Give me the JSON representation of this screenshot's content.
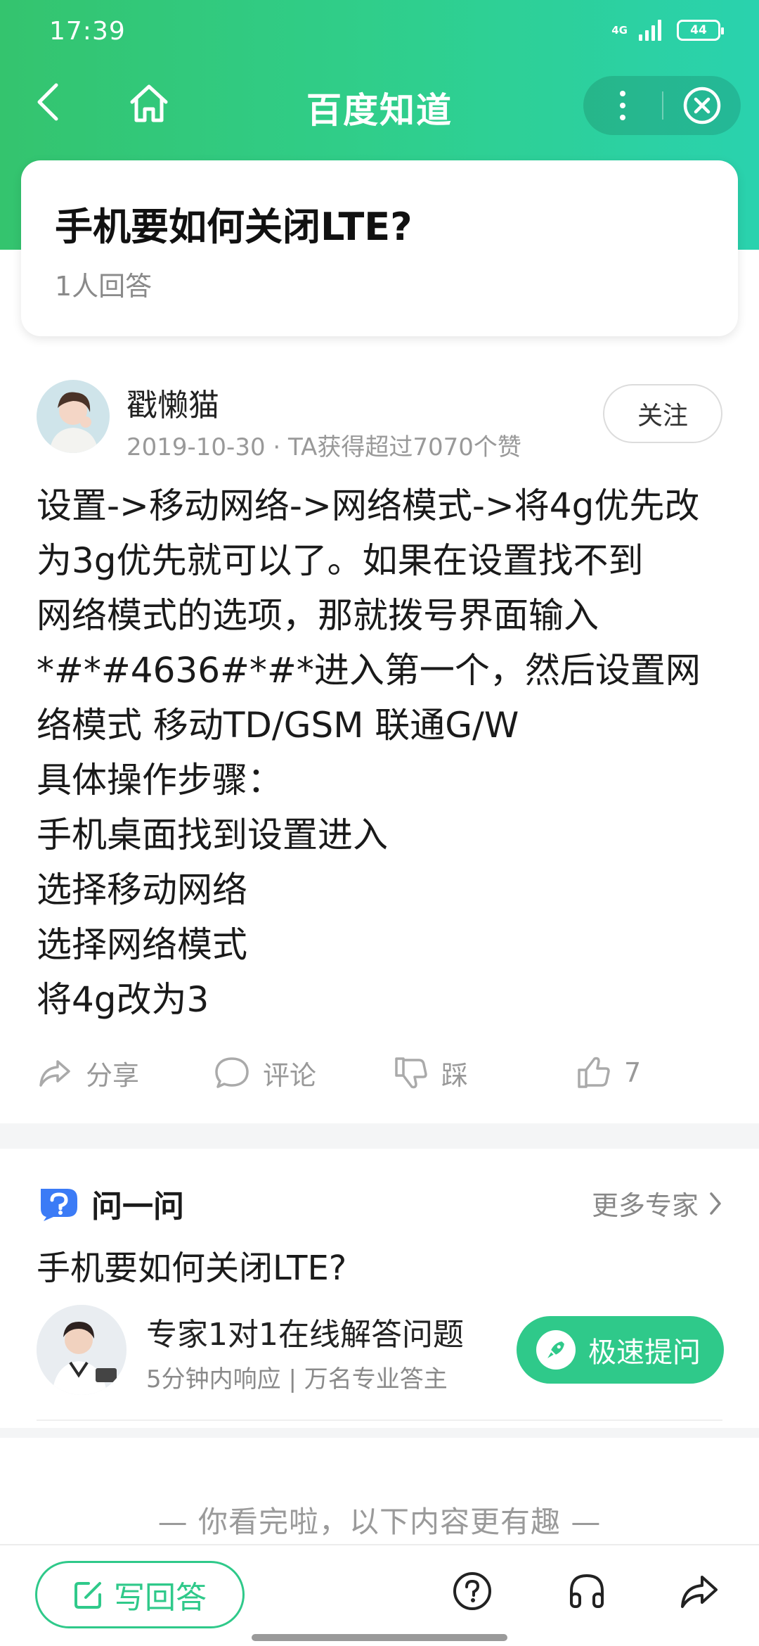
{
  "status_bar": {
    "time": "17:39",
    "network": "4G",
    "battery": "44"
  },
  "nav": {
    "title": "百度知道",
    "back_icon": "back-arrow-icon",
    "home_icon": "home-icon",
    "more_icon": "more-dots-icon",
    "close_icon": "close-circle-icon"
  },
  "question": {
    "title": "手机要如何关闭LTE?",
    "answer_count": "1人回答"
  },
  "answer": {
    "author": "戳懒猫",
    "meta": "2019-10-30 · TA获得超过7070个赞",
    "follow_label": "关注",
    "lines": [
      "设置->移动网络->网络模式->将4g优先改",
      "为3g优先就可以了。如果在设置找不到",
      "网络模式的选项，那就拨号界面输入",
      "*#*#4636#*#*进入第一个，然后设置网",
      "络模式 移动TD/GSM 联通G/W",
      "具体操作步骤：",
      "手机桌面找到设置进入",
      "选择移动网络",
      "选择网络模式",
      "将4g改为3"
    ],
    "actions": {
      "share": "分享",
      "comment": "评论",
      "dislike": "踩",
      "like_count": "7"
    }
  },
  "ask_section": {
    "logo_text": "问一问",
    "more_experts": "更多专家",
    "question": "手机要如何关闭LTE?",
    "expert_title": "专家1对1在线解答问题",
    "expert_sub": "5分钟内响应 | 万名专业答主",
    "fast_ask_label": "极速提问"
  },
  "end_note": "— 你看完啦，以下内容更有趣 —",
  "bottom_bar": {
    "write_label": "写回答",
    "icons": [
      "help-icon",
      "headphones-icon",
      "share-icon"
    ]
  },
  "colors": {
    "brand_green": "#2fc98a",
    "header_gradient_start": "#34c46e",
    "header_gradient_end": "#2ad2ae"
  }
}
